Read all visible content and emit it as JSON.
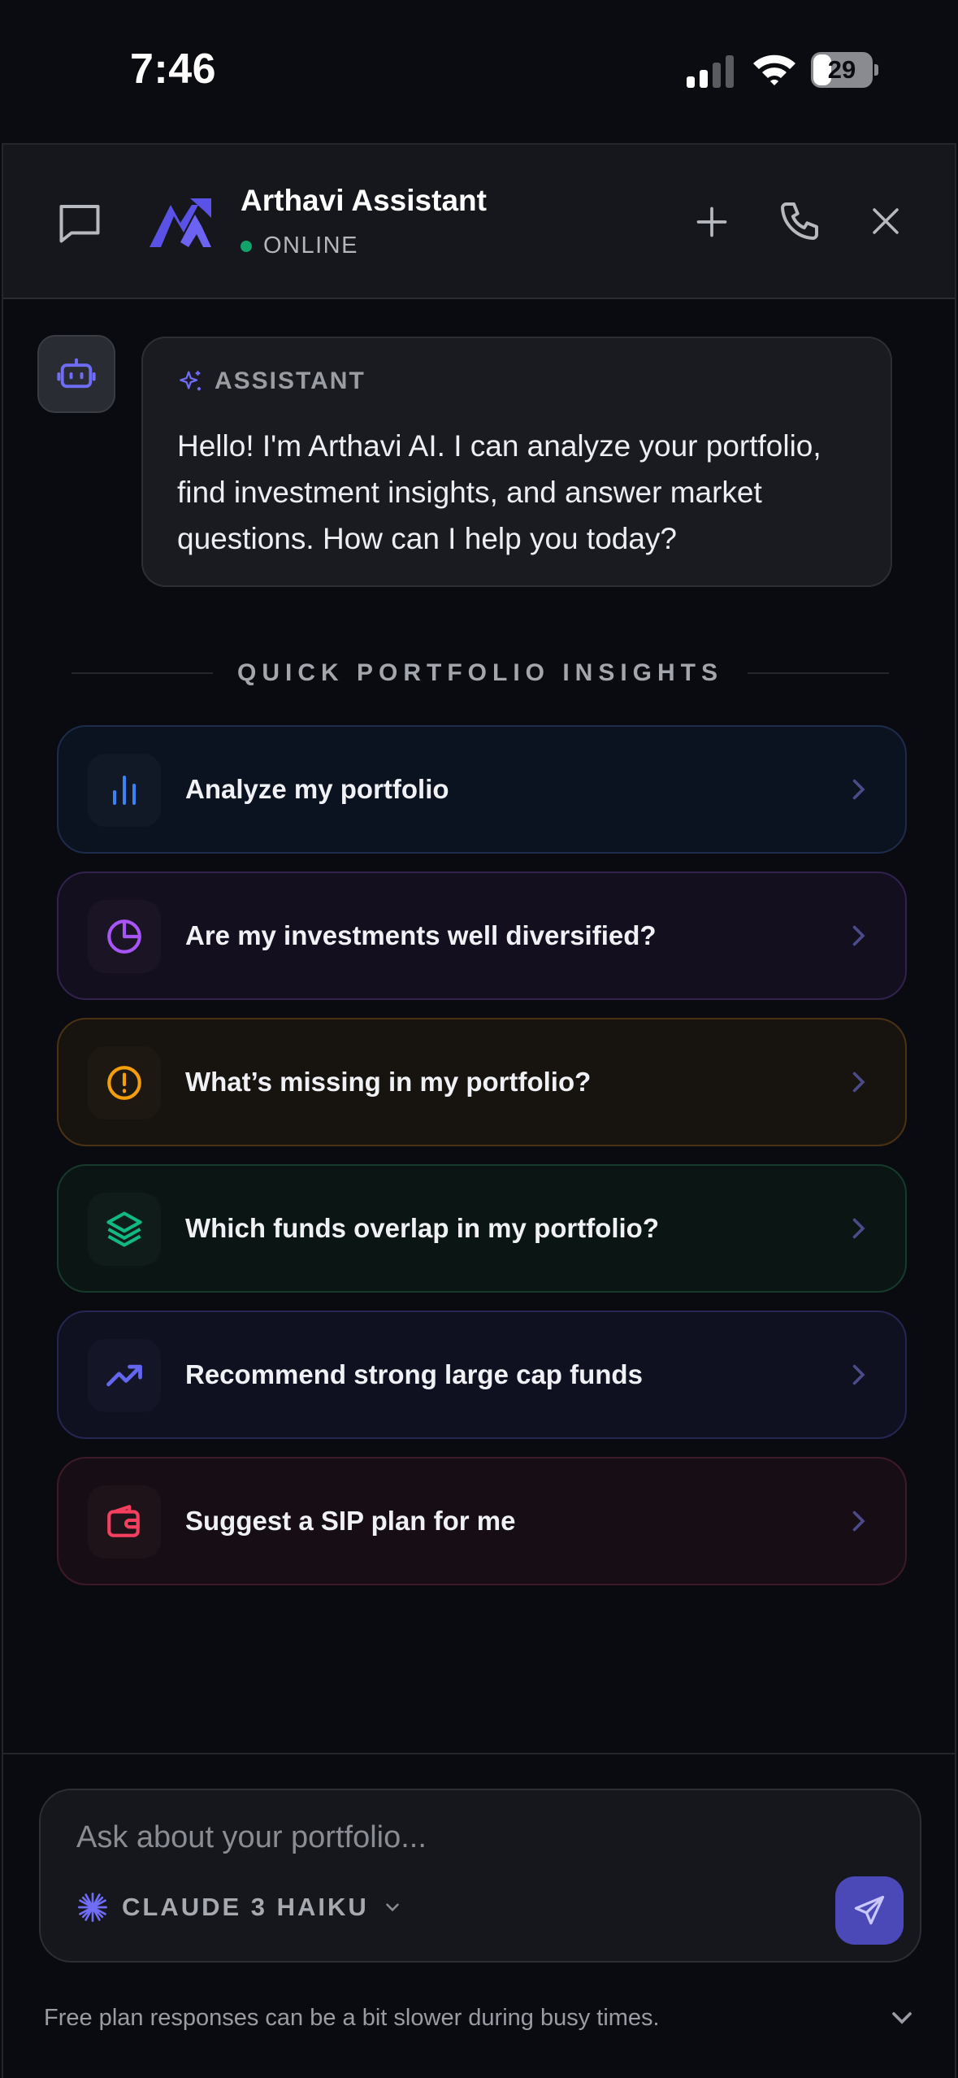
{
  "status_bar": {
    "time": "7:46",
    "battery": "29"
  },
  "header": {
    "title": "Arthavi Assistant",
    "status": "ONLINE",
    "icons": [
      "chat-icon",
      "arthavi-logo",
      "plus-icon",
      "phone-icon",
      "close-icon"
    ]
  },
  "message": {
    "role_label": "ASSISTANT",
    "text": "Hello! I'm Arthavi AI. I can analyze your portfolio, find investment insights, and answer market questions. How can I help you today?"
  },
  "insights": {
    "title": "QUICK PORTFOLIO INSIGHTS",
    "items": [
      {
        "label": "Analyze my portfolio",
        "icon": "bar-chart-icon",
        "color": "#3b82f6"
      },
      {
        "label": "Are my investments well diversified?",
        "icon": "pie-chart-icon",
        "color": "#a855f7"
      },
      {
        "label": "What’s missing in my portfolio?",
        "icon": "alert-circle-icon",
        "color": "#f59e0b"
      },
      {
        "label": "Which funds overlap in my portfolio?",
        "icon": "layers-icon",
        "color": "#10b981"
      },
      {
        "label": "Recommend strong large cap funds",
        "icon": "trending-up-icon",
        "color": "#6366f1"
      },
      {
        "label": "Suggest a SIP plan for me",
        "icon": "wallet-icon",
        "color": "#f43f5e"
      }
    ]
  },
  "composer": {
    "placeholder": "Ask about your portfolio...",
    "model": "CLAUDE 3 HAIKU"
  },
  "footer": {
    "note": "Free plan responses can be a bit slower during busy times."
  }
}
